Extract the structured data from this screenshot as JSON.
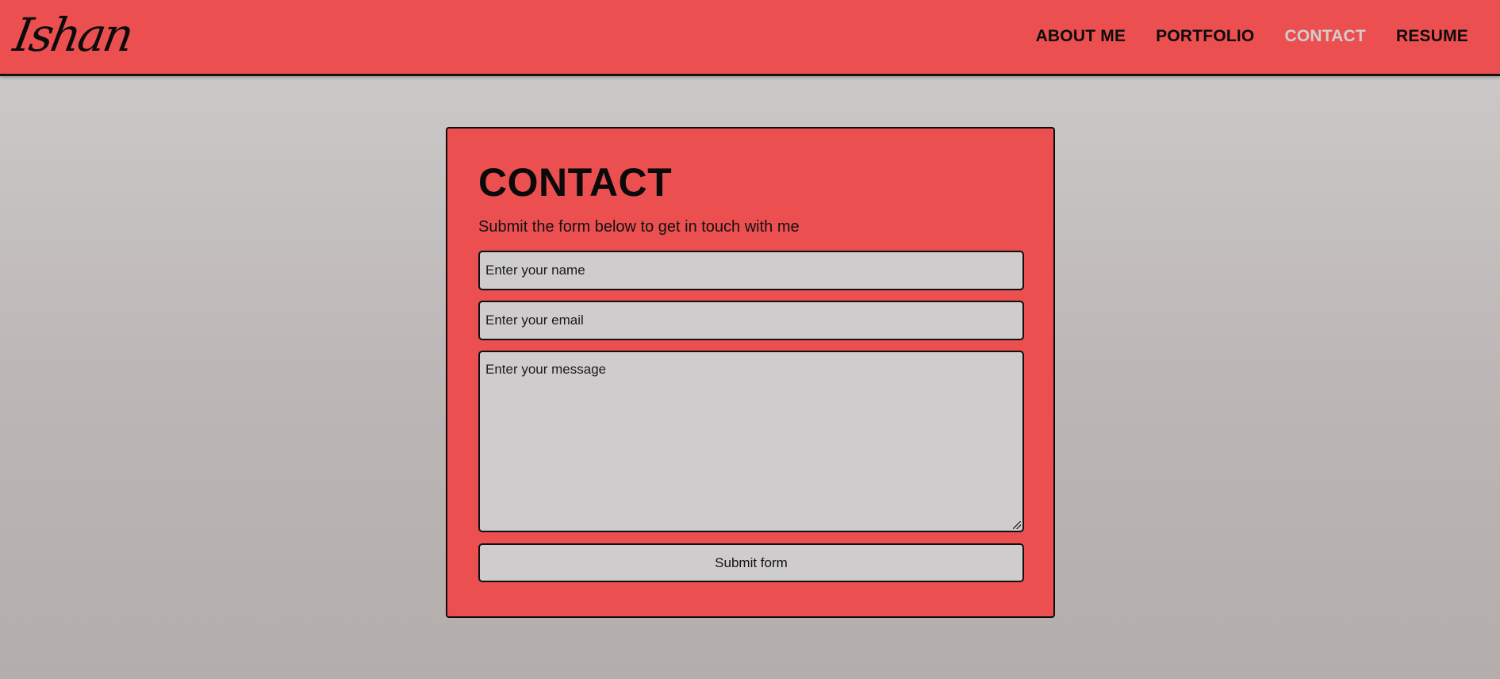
{
  "header": {
    "logo_text": "Ishan",
    "nav": [
      {
        "label": "ABOUT ME"
      },
      {
        "label": "PORTFOLIO"
      },
      {
        "label": "CONTACT",
        "active": true
      },
      {
        "label": "RESUME"
      }
    ],
    "background_color": "#ec4f50",
    "active_nav_color": "#d2cecd"
  },
  "contact": {
    "title": "CONTACT",
    "subtitle": "Submit the form below to get in touch with me",
    "name_placeholder": "Enter your name",
    "email_placeholder": "Enter your email",
    "message_placeholder": "Enter your message",
    "submit_label": "Submit form"
  },
  "icons": [
    "resize-grip-icon"
  ]
}
